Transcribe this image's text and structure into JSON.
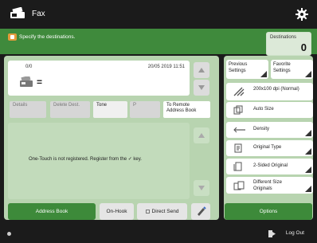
{
  "app": {
    "title": "Fax"
  },
  "message": {
    "text": "Specify the destinations."
  },
  "destinations": {
    "label": "Destinations",
    "count": "0"
  },
  "preview": {
    "id": "0/0",
    "datetime": "20/05 2019 11:51",
    "value": "="
  },
  "tabs": {
    "details": "Details",
    "delete_dest": "Delete Dest.",
    "tone": "Tone",
    "pause": "P",
    "to_remote": "To Remote Address Book"
  },
  "info": {
    "text": "One-Touch is not registered. Register from the ✓ key."
  },
  "bottom": {
    "address_book": "Address Book",
    "on_hook": "On-Hook",
    "direct_send": "Direct Send",
    "options": "Options"
  },
  "settings": {
    "previous": "Previous Settings",
    "favorite": "Favorite Settings",
    "resolution": "200x100 dpi (Normal)",
    "auto_size": "Auto Size",
    "density": "Density",
    "original_type": "Original Type",
    "two_sided": "2-Sided Original",
    "different_size": "Different Size Originals"
  },
  "status": {
    "logout": "Log Out"
  },
  "colors": {
    "accent_green": "#3d8a3a",
    "panel_green": "#b8d4b0",
    "message_bar": "#3f8a3c",
    "dark": "#1b1b1b"
  }
}
